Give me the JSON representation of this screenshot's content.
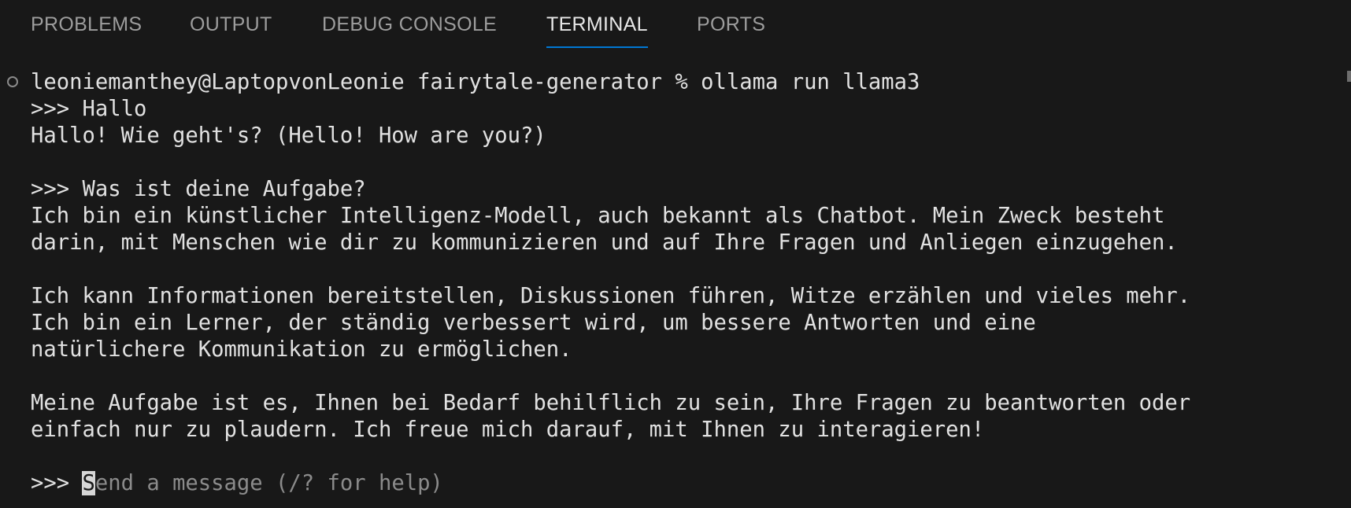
{
  "tabs": [
    {
      "label": "PROBLEMS",
      "active": false
    },
    {
      "label": "OUTPUT",
      "active": false
    },
    {
      "label": "DEBUG CONSOLE",
      "active": false
    },
    {
      "label": "TERMINAL",
      "active": true
    },
    {
      "label": "PORTS",
      "active": false
    }
  ],
  "terminal": {
    "lines": [
      "leoniemanthey@LaptopvonLeonie fairytale-generator % ollama run llama3",
      ">>> Hallo",
      "Hallo! Wie geht's? (Hello! How are you?)",
      "",
      ">>> Was ist deine Aufgabe?",
      "Ich bin ein künstlicher Intelligenz-Modell, auch bekannt als Chatbot. Mein Zweck besteht",
      "darin, mit Menschen wie dir zu kommunizieren und auf Ihre Fragen und Anliegen einzugehen.",
      "",
      "Ich kann Informationen bereitstellen, Diskussionen führen, Witze erzählen und vieles mehr.",
      "Ich bin ein Lerner, der ständig verbessert wird, um bessere Antworten und eine",
      "natürlichere Kommunikation zu ermöglichen.",
      "",
      "Meine Aufgabe ist es, Ihnen bei Bedarf behilflich zu sein, Ihre Fragen zu beantworten oder",
      "einfach nur zu plaudern. Ich freue mich darauf, mit Ihnen zu interagieren!",
      ""
    ],
    "prompt": {
      "prefix": ">>> ",
      "cursor_char": "S",
      "placeholder_rest": "end a message (/? for help)"
    }
  },
  "colors": {
    "background": "#181818",
    "active_tab_underline": "#0078d4",
    "text": "#e1e1e1",
    "placeholder": "#8b8b8b"
  }
}
